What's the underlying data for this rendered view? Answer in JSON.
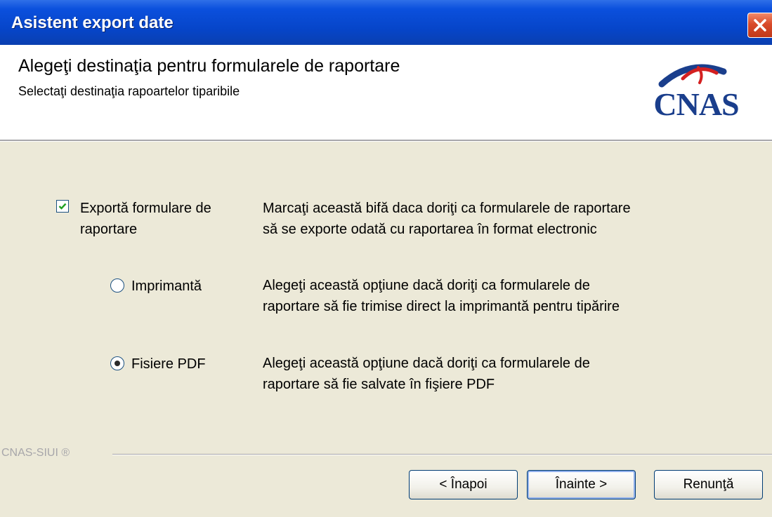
{
  "window": {
    "title": "Asistent export date"
  },
  "header": {
    "title": "Alegeţi destinaţia pentru formularele de raportare",
    "subtitle": "Selectaţi destinaţia rapoartelor tiparibile",
    "logo_text": "CNAS"
  },
  "options": {
    "export": {
      "label_line1": "Exportă formulare de",
      "label_line2": "raportare",
      "checked": true,
      "desc_line1": "Marcaţi această bifă daca doriţi ca formularele de raportare",
      "desc_line2": "să se exporte odată cu raportarea în format electronic"
    },
    "printer": {
      "label": "Imprimantă",
      "selected": false,
      "desc_line1": "Alegeţi această opţiune dacă doriţi ca formularele de",
      "desc_line2": "raportare să fie trimise direct la imprimantă pentru tipărire"
    },
    "pdf": {
      "label": "Fisiere PDF",
      "selected": true,
      "desc_line1": "Alegeţi această opţiune dacă doriţi ca formularele de",
      "desc_line2": "raportare să fie salvate în fişiere PDF"
    }
  },
  "footer": {
    "brand": "CNAS-SIUI ®",
    "back_label": "< Înapoi",
    "next_label": "Înainte >",
    "cancel_label": "Renunţă"
  },
  "colors": {
    "titlebar": "#0a4fd8",
    "dialog_bg": "#ece9d8",
    "logo_blue": "#1a3e8c",
    "logo_red": "#d42020"
  }
}
